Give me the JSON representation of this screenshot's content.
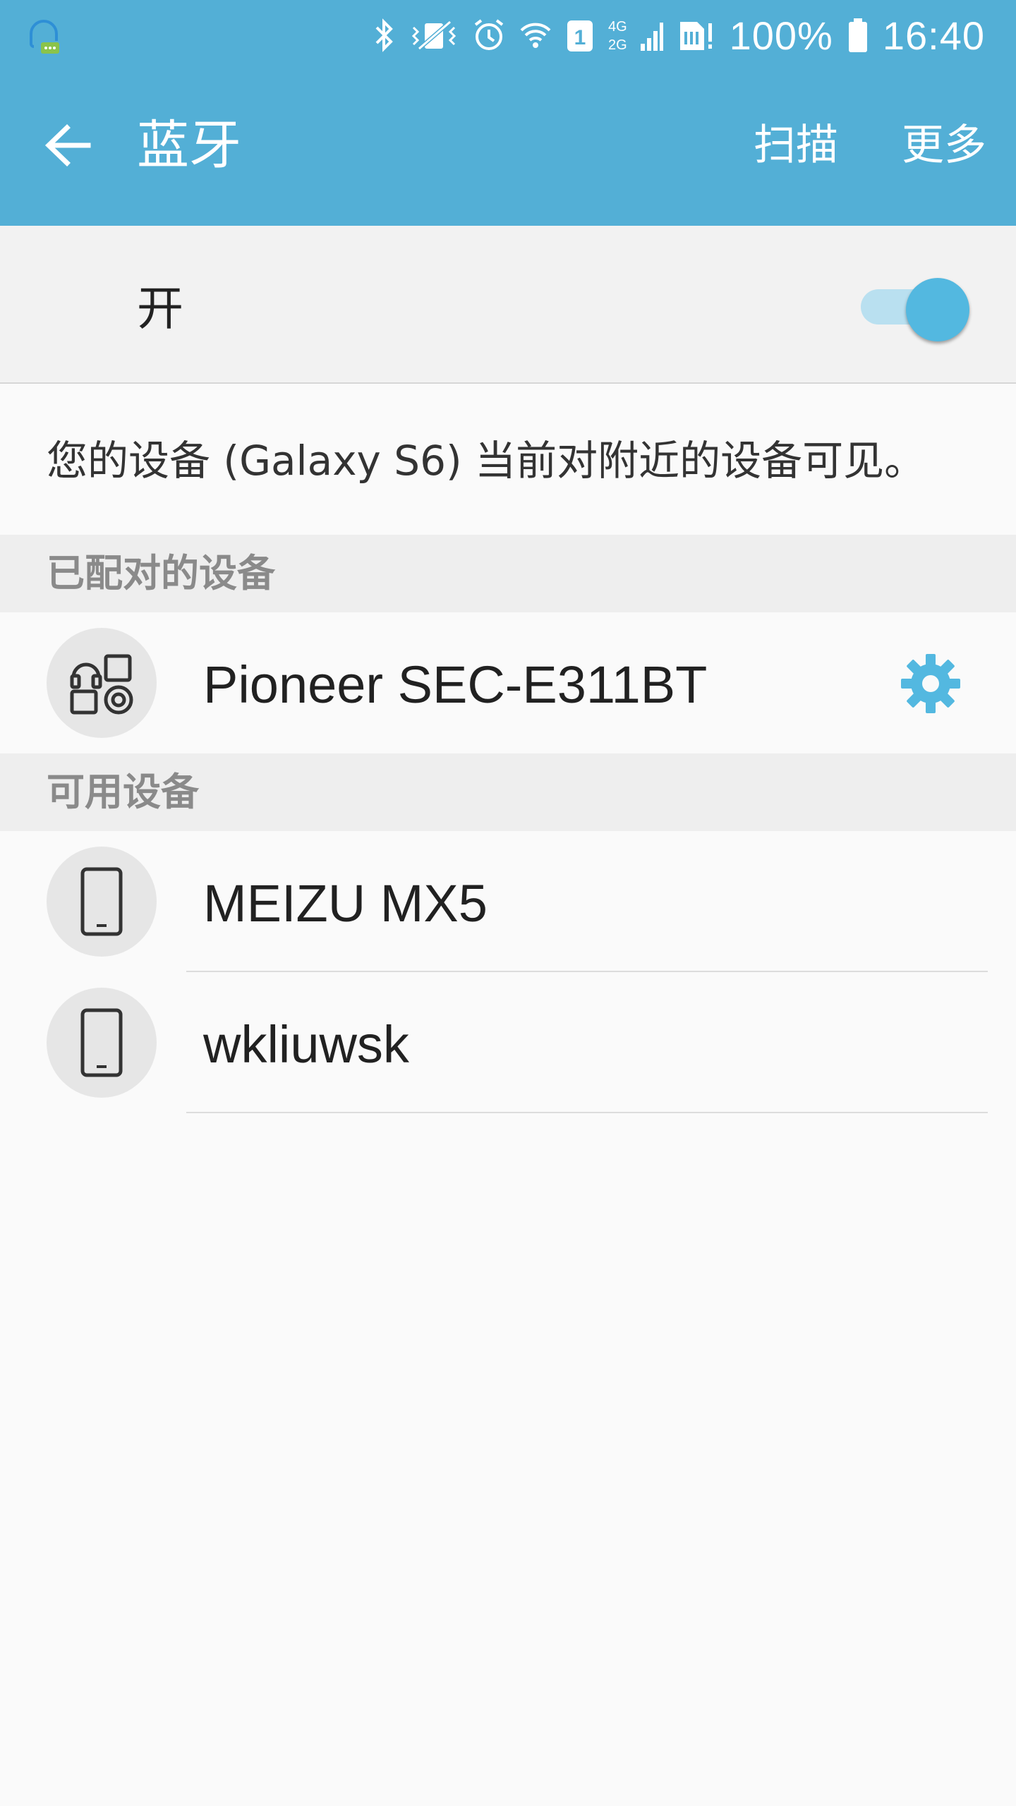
{
  "status_bar": {
    "battery_text": "100%",
    "time": "16:40",
    "sim_slot": "1",
    "network_top": "4G",
    "network_bottom": "2G"
  },
  "toolbar": {
    "title": "蓝牙",
    "scan_label": "扫描",
    "more_label": "更多"
  },
  "bluetooth_switch": {
    "label": "开",
    "checked": true
  },
  "visibility": {
    "text": "您的设备 (Galaxy S6) 当前对附近的设备可见。"
  },
  "paired_devices": {
    "header": "已配对的设备",
    "items": [
      {
        "name": "Pioneer SEC-E311BT",
        "icon": "headphones-speaker-icon"
      }
    ]
  },
  "available_devices": {
    "header": "可用设备",
    "items": [
      {
        "name": "MEIZU MX5",
        "icon": "phone-icon"
      },
      {
        "name": "wkliuwsk",
        "icon": "phone-icon"
      }
    ]
  },
  "colors": {
    "header_bg": "#53afd6",
    "accent": "#53b8e0",
    "section_bg": "#eeeeee"
  }
}
